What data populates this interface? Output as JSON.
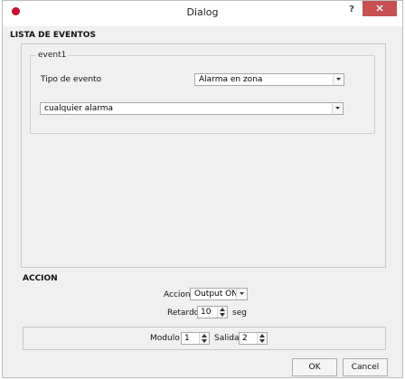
{
  "window": {
    "title": "Dialog",
    "help_label": "?"
  },
  "eventos": {
    "section_title": "LISTA DE EVENTOS",
    "group_title": "event1",
    "tipo_label": "Tipo de evento",
    "tipo_value": "Alarma en zona",
    "detalle_value": "cualquier alarma"
  },
  "accion": {
    "section_title": "ACCION",
    "accion_label": "Accion",
    "accion_value": "Output ON",
    "retardo_label": "Retardo",
    "retardo_value": "10",
    "retardo_unit": "seg",
    "modulo_label": "Modulo",
    "modulo_value": "1",
    "salida_label": "Salida",
    "salida_value": "2"
  },
  "buttons": {
    "ok": "OK",
    "cancel": "Cancel"
  },
  "colors": {
    "close_button": "#c75050",
    "app_icon": "#c8102e"
  }
}
